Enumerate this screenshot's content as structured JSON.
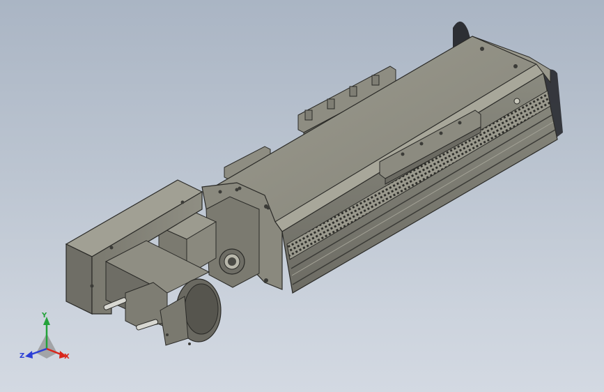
{
  "viewport": {
    "background_top": "#aab5c4",
    "background_bottom": "#d3d9e2"
  },
  "model": {
    "body_color": "#7d7c72",
    "body_light": "#979689",
    "body_dark": "#53524b",
    "edge_color": "#2a2a27",
    "shadow_color": "#1f2024"
  },
  "triad": {
    "labels": {
      "x": "X",
      "y": "Y",
      "z": "Z"
    },
    "colors": {
      "x": "#d9261c",
      "y": "#23a23a",
      "z": "#2c3fd6"
    },
    "icon": "coordinate-triad-icon"
  }
}
